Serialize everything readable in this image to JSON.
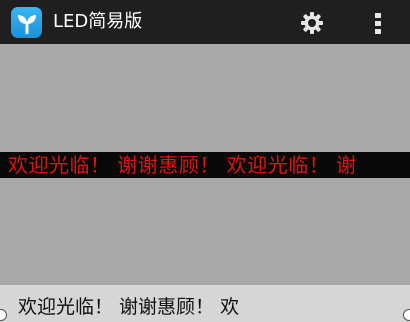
{
  "app": {
    "title": "LED简易版",
    "icon": "app-sprout-icon",
    "accent_color": "#2aa6e8"
  },
  "toolbar": {
    "settings_icon": "gear-icon",
    "overflow_icon": "overflow-menu-icon"
  },
  "display": {
    "scroll_text": "欢迎光临！ 谢谢惠顾！ 欢迎光临！ 谢",
    "text_color": "#e0140f",
    "band_color": "#080808",
    "stage_color": "#a9a9a9"
  },
  "input": {
    "value": "欢迎光临！ 谢谢惠顾！ 欢"
  }
}
